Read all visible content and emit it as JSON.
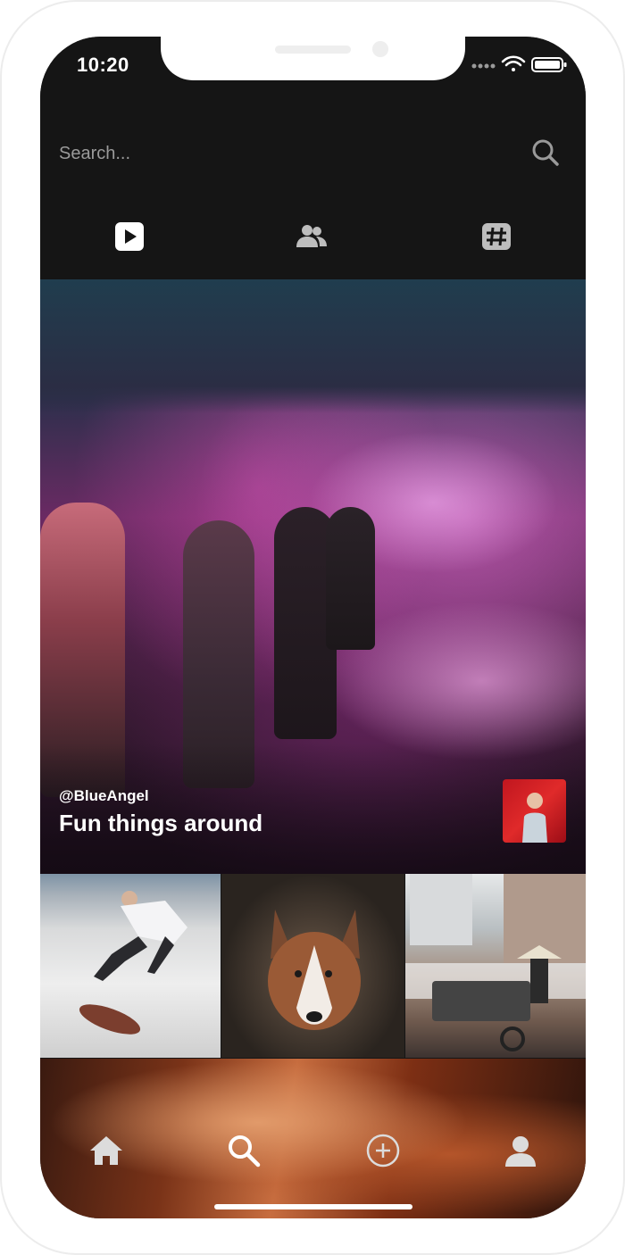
{
  "status_bar": {
    "time": "10:20"
  },
  "search": {
    "placeholder": "Search..."
  },
  "tabs": [
    {
      "name": "videos",
      "icon": "play-icon",
      "active": true
    },
    {
      "name": "people",
      "icon": "people-icon",
      "active": false
    },
    {
      "name": "tags",
      "icon": "hashtag-icon",
      "active": false
    }
  ],
  "featured": {
    "username": "@BlueAngel",
    "title": "Fun things around"
  },
  "grid": [
    {
      "subject": "skateboarder"
    },
    {
      "subject": "husky dog"
    },
    {
      "subject": "street vendor"
    }
  ],
  "bottom_nav": [
    {
      "icon": "home-icon"
    },
    {
      "icon": "search-icon",
      "active": true
    },
    {
      "icon": "add-circle-icon"
    },
    {
      "icon": "profile-icon"
    }
  ],
  "colors": {
    "background": "#151515",
    "text": "#ffffff",
    "muted": "#9a9a9a",
    "inactive_icon": "#bdbdbd"
  }
}
